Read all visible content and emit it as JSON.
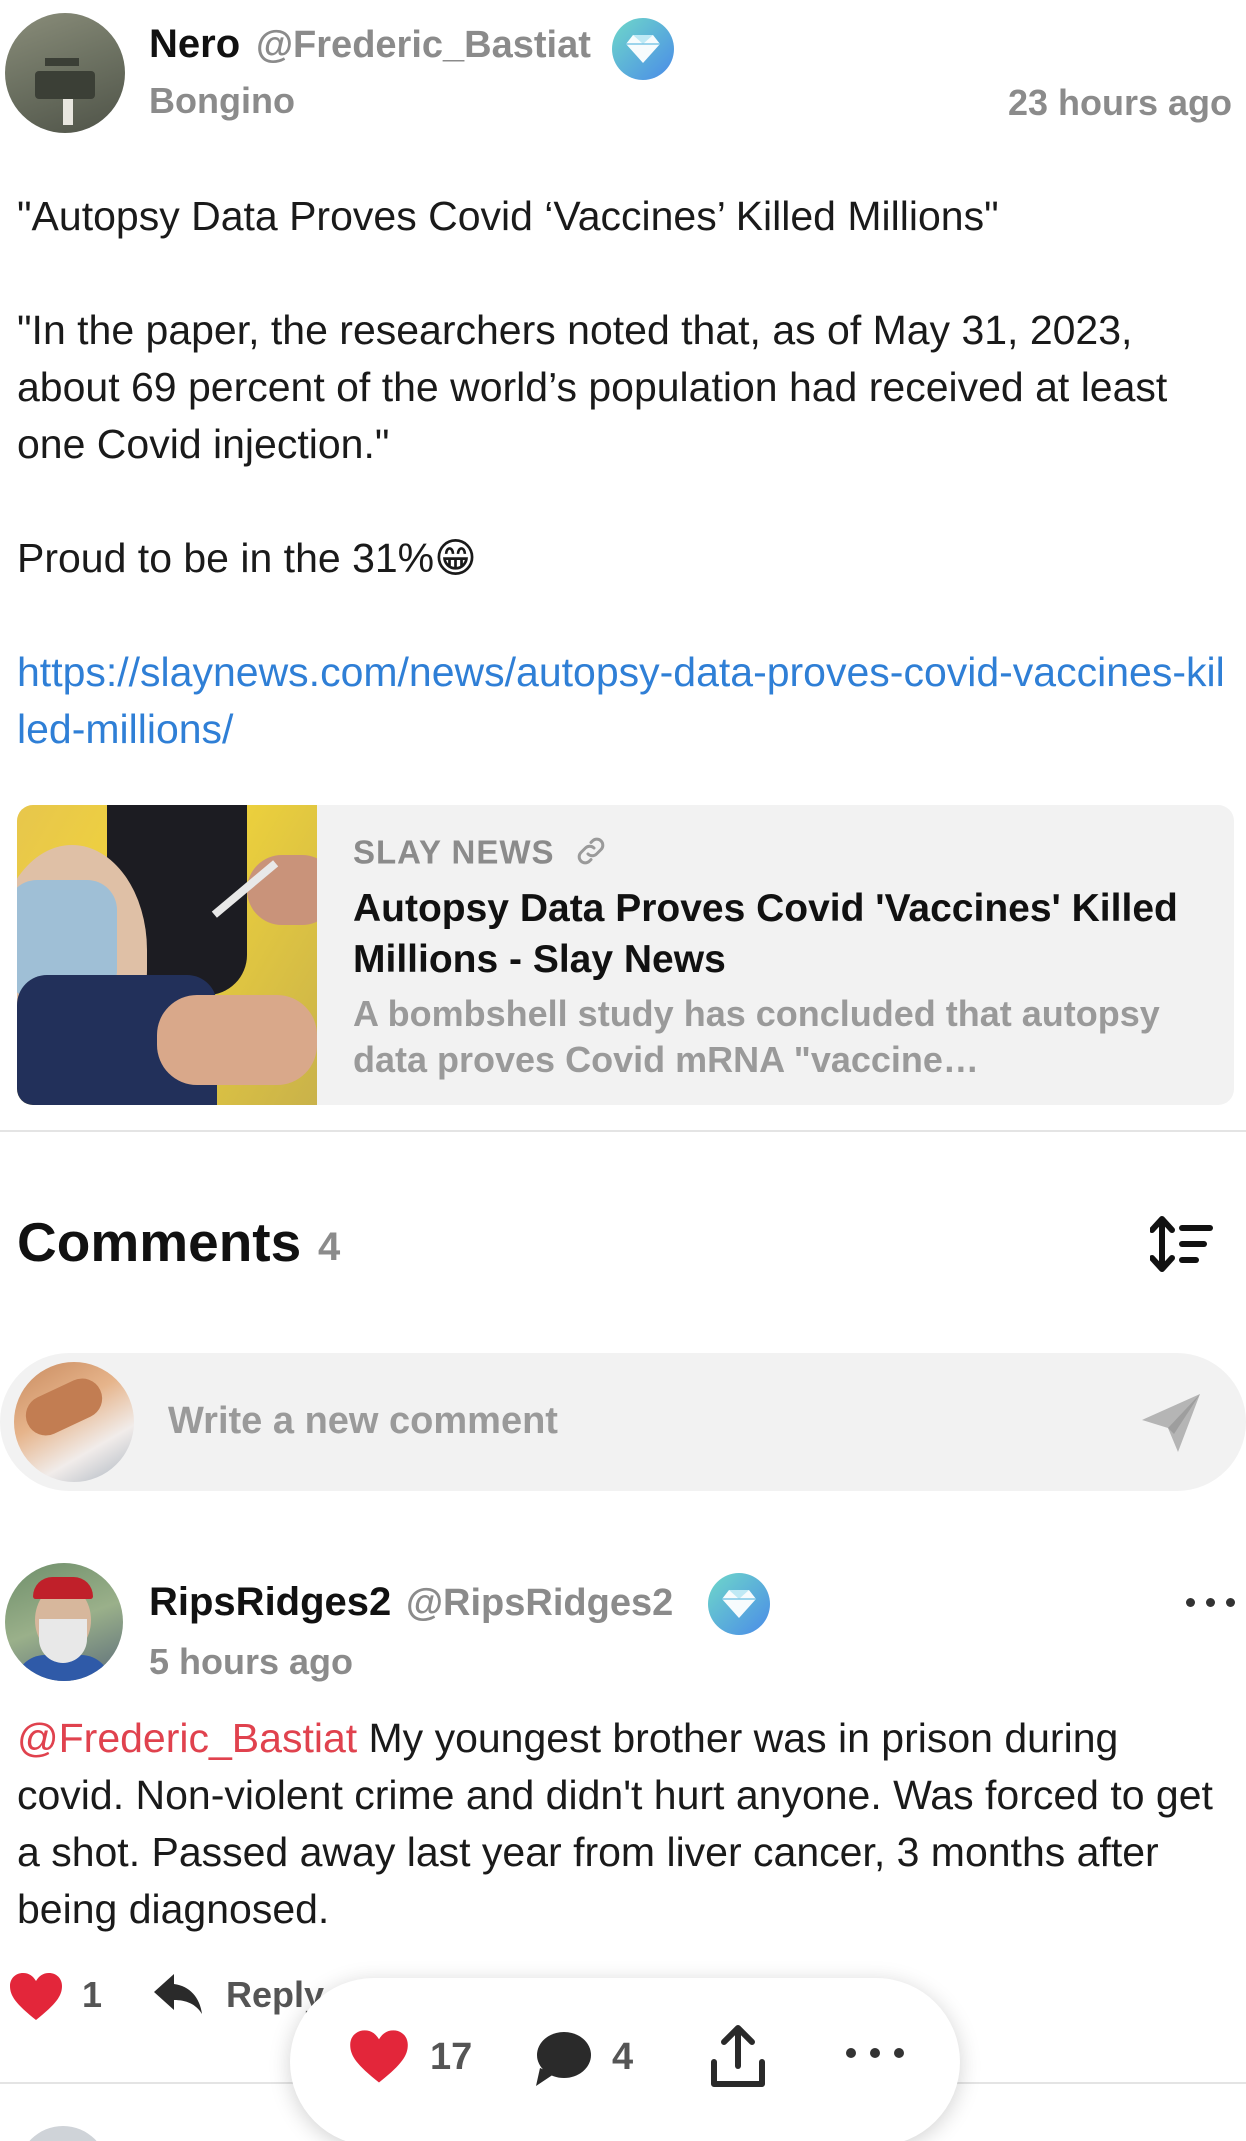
{
  "post": {
    "author_name": "Nero",
    "author_handle": "@Frederic_Bastiat",
    "author_subtitle": "Bongino",
    "timestamp": "23 hours ago",
    "verified_icon": "gem-verified-icon",
    "paragraphs": [
      "\"Autopsy Data Proves Covid ‘Vaccines’ Killed Millions\"",
      "\"In the paper, the researchers noted that, as of May 31, 2023, about 69 percent of the world’s population had received at least one Covid injection.\"",
      "Proud to be in the 31%😁"
    ],
    "link_url": "https://slaynews.com/news/autopsy-data-proves-covid-vaccines-killed-millions/",
    "link_card": {
      "source": "SLAY NEWS",
      "title": "Autopsy Data Proves Covid 'Vaccines' Killed Millions - Slay News",
      "description": "A bombshell study has concluded that autopsy data proves Covid mRNA \"vaccine…"
    }
  },
  "comments_section": {
    "title": "Comments",
    "count": "4",
    "sort_icon": "sort-icon",
    "input_placeholder": "Write a new comment",
    "send_icon": "send-icon"
  },
  "comment": {
    "name": "RipsRidges2",
    "handle": "@RipsRidges2",
    "time": "5 hours ago",
    "mention": "@Frederic_Bastiat",
    "text": " My youngest brother was in prison during covid. Non-violent crime and didn't hurt anyone. Was forced to get a shot. Passed away last year from liver cancer, 3 months after being diagnosed.",
    "like_count": "1",
    "reply_label": "Reply"
  },
  "action_bar": {
    "like_count": "17",
    "comment_count": "4"
  },
  "colors": {
    "link": "#2f7fd6",
    "mention": "#e0424e",
    "heart": "#e3263a",
    "muted": "#8b8b8b"
  }
}
